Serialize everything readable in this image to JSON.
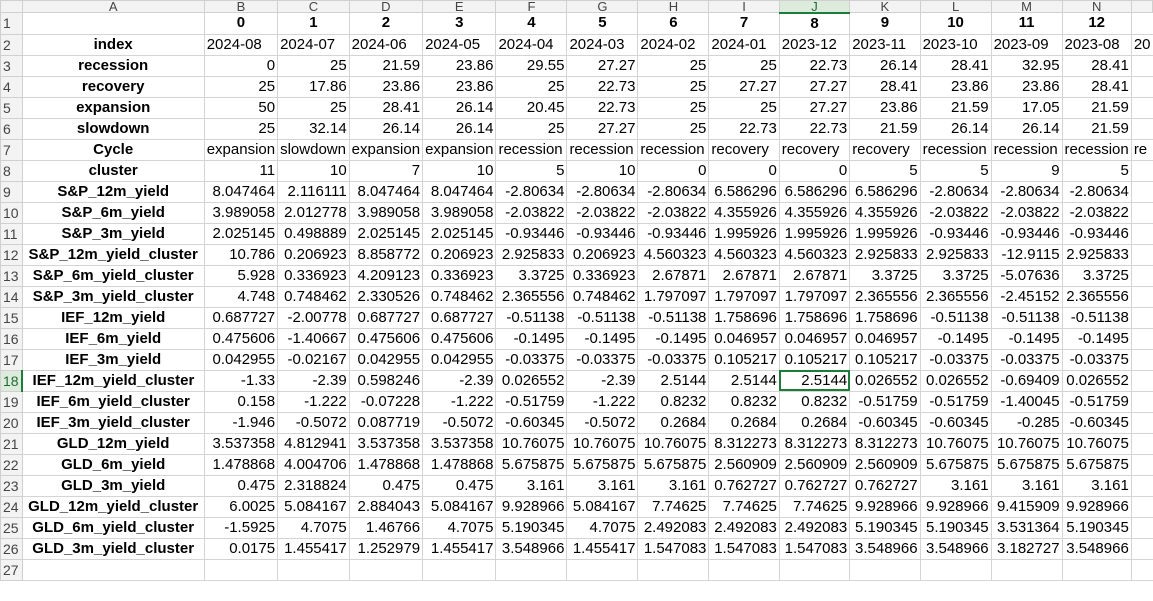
{
  "columns": [
    "A",
    "B",
    "C",
    "D",
    "E",
    "F",
    "G",
    "H",
    "I",
    "J",
    "K",
    "L",
    "M",
    "N",
    ""
  ],
  "selected_column": "J",
  "selected_row": "18",
  "rows": [
    {
      "n": "1",
      "label": "",
      "cells": [
        "0",
        "1",
        "2",
        "3",
        "4",
        "5",
        "6",
        "7",
        "8",
        "9",
        "10",
        "11",
        "12",
        ""
      ],
      "kind": "hdr"
    },
    {
      "n": "2",
      "label": "index",
      "cells": [
        "2024-08",
        "2024-07",
        "2024-06",
        "2024-05",
        "2024-04",
        "2024-03",
        "2024-02",
        "2024-01",
        "2023-12",
        "2023-11",
        "2023-10",
        "2023-09",
        "2023-08",
        "20"
      ],
      "kind": "txt"
    },
    {
      "n": "3",
      "label": "recession",
      "cells": [
        "0",
        "25",
        "21.59",
        "23.86",
        "29.55",
        "27.27",
        "25",
        "25",
        "22.73",
        "26.14",
        "28.41",
        "32.95",
        "28.41",
        ""
      ],
      "kind": "num"
    },
    {
      "n": "4",
      "label": "recovery",
      "cells": [
        "25",
        "17.86",
        "23.86",
        "23.86",
        "25",
        "22.73",
        "25",
        "27.27",
        "27.27",
        "28.41",
        "23.86",
        "23.86",
        "28.41",
        ""
      ],
      "kind": "num"
    },
    {
      "n": "5",
      "label": "expansion",
      "cells": [
        "50",
        "25",
        "28.41",
        "26.14",
        "20.45",
        "22.73",
        "25",
        "25",
        "27.27",
        "23.86",
        "21.59",
        "17.05",
        "21.59",
        ""
      ],
      "kind": "num"
    },
    {
      "n": "6",
      "label": "slowdown",
      "cells": [
        "25",
        "32.14",
        "26.14",
        "26.14",
        "25",
        "27.27",
        "25",
        "22.73",
        "22.73",
        "21.59",
        "26.14",
        "26.14",
        "21.59",
        ""
      ],
      "kind": "num"
    },
    {
      "n": "7",
      "label": "Cycle",
      "cells": [
        "expansion",
        "slowdown",
        "expansion",
        "expansion",
        "recession",
        "recession",
        "recession",
        "recovery",
        "recovery",
        "recovery",
        "recession",
        "recession",
        "recession",
        "re"
      ],
      "kind": "txt"
    },
    {
      "n": "8",
      "label": "cluster",
      "cells": [
        "11",
        "10",
        "7",
        "10",
        "5",
        "10",
        "0",
        "0",
        "0",
        "5",
        "5",
        "9",
        "5",
        ""
      ],
      "kind": "num"
    },
    {
      "n": "9",
      "label": "S&P_12m_yield",
      "cells": [
        "8.047464",
        "2.116111",
        "8.047464",
        "8.047464",
        "-2.80634",
        "-2.80634",
        "-2.80634",
        "6.586296",
        "6.586296",
        "6.586296",
        "-2.80634",
        "-2.80634",
        "-2.80634",
        ""
      ],
      "kind": "num"
    },
    {
      "n": "10",
      "label": "S&P_6m_yield",
      "cells": [
        "3.989058",
        "2.012778",
        "3.989058",
        "3.989058",
        "-2.03822",
        "-2.03822",
        "-2.03822",
        "4.355926",
        "4.355926",
        "4.355926",
        "-2.03822",
        "-2.03822",
        "-2.03822",
        ""
      ],
      "kind": "num"
    },
    {
      "n": "11",
      "label": "S&P_3m_yield",
      "cells": [
        "2.025145",
        "0.498889",
        "2.025145",
        "2.025145",
        "-0.93446",
        "-0.93446",
        "-0.93446",
        "1.995926",
        "1.995926",
        "1.995926",
        "-0.93446",
        "-0.93446",
        "-0.93446",
        ""
      ],
      "kind": "num"
    },
    {
      "n": "12",
      "label": "S&P_12m_yield_cluster",
      "cells": [
        "10.786",
        "0.206923",
        "8.858772",
        "0.206923",
        "2.925833",
        "0.206923",
        "4.560323",
        "4.560323",
        "4.560323",
        "2.925833",
        "2.925833",
        "-12.9115",
        "2.925833",
        ""
      ],
      "kind": "num"
    },
    {
      "n": "13",
      "label": "S&P_6m_yield_cluster",
      "cells": [
        "5.928",
        "0.336923",
        "4.209123",
        "0.336923",
        "3.3725",
        "0.336923",
        "2.67871",
        "2.67871",
        "2.67871",
        "3.3725",
        "3.3725",
        "-5.07636",
        "3.3725",
        ""
      ],
      "kind": "num"
    },
    {
      "n": "14",
      "label": "S&P_3m_yield_cluster",
      "cells": [
        "4.748",
        "0.748462",
        "2.330526",
        "0.748462",
        "2.365556",
        "0.748462",
        "1.797097",
        "1.797097",
        "1.797097",
        "2.365556",
        "2.365556",
        "-2.45152",
        "2.365556",
        ""
      ],
      "kind": "num"
    },
    {
      "n": "15",
      "label": "IEF_12m_yield",
      "cells": [
        "0.687727",
        "-2.00778",
        "0.687727",
        "0.687727",
        "-0.51138",
        "-0.51138",
        "-0.51138",
        "1.758696",
        "1.758696",
        "1.758696",
        "-0.51138",
        "-0.51138",
        "-0.51138",
        ""
      ],
      "kind": "num"
    },
    {
      "n": "16",
      "label": "IEF_6m_yield",
      "cells": [
        "0.475606",
        "-1.40667",
        "0.475606",
        "0.475606",
        "-0.1495",
        "-0.1495",
        "-0.1495",
        "0.046957",
        "0.046957",
        "0.046957",
        "-0.1495",
        "-0.1495",
        "-0.1495",
        ""
      ],
      "kind": "num"
    },
    {
      "n": "17",
      "label": "IEF_3m_yield",
      "cells": [
        "0.042955",
        "-0.02167",
        "0.042955",
        "0.042955",
        "-0.03375",
        "-0.03375",
        "-0.03375",
        "0.105217",
        "0.105217",
        "0.105217",
        "-0.03375",
        "-0.03375",
        "-0.03375",
        ""
      ],
      "kind": "num"
    },
    {
      "n": "18",
      "label": "IEF_12m_yield_cluster",
      "cells": [
        "-1.33",
        "-2.39",
        "0.598246",
        "-2.39",
        "0.026552",
        "-2.39",
        "2.5144",
        "2.5144",
        "2.5144",
        "0.026552",
        "0.026552",
        "-0.69409",
        "0.026552",
        ""
      ],
      "kind": "num"
    },
    {
      "n": "19",
      "label": "IEF_6m_yield_cluster",
      "cells": [
        "0.158",
        "-1.222",
        "-0.07228",
        "-1.222",
        "-0.51759",
        "-1.222",
        "0.8232",
        "0.8232",
        "0.8232",
        "-0.51759",
        "-0.51759",
        "-1.40045",
        "-0.51759",
        ""
      ],
      "kind": "num"
    },
    {
      "n": "20",
      "label": "IEF_3m_yield_cluster",
      "cells": [
        "-1.946",
        "-0.5072",
        "0.087719",
        "-0.5072",
        "-0.60345",
        "-0.5072",
        "0.2684",
        "0.2684",
        "0.2684",
        "-0.60345",
        "-0.60345",
        "-0.285",
        "-0.60345",
        ""
      ],
      "kind": "num"
    },
    {
      "n": "21",
      "label": "GLD_12m_yield",
      "cells": [
        "3.537358",
        "4.812941",
        "3.537358",
        "3.537358",
        "10.76075",
        "10.76075",
        "10.76075",
        "8.312273",
        "8.312273",
        "8.312273",
        "10.76075",
        "10.76075",
        "10.76075",
        ""
      ],
      "kind": "num"
    },
    {
      "n": "22",
      "label": "GLD_6m_yield",
      "cells": [
        "1.478868",
        "4.004706",
        "1.478868",
        "1.478868",
        "5.675875",
        "5.675875",
        "5.675875",
        "2.560909",
        "2.560909",
        "2.560909",
        "5.675875",
        "5.675875",
        "5.675875",
        ""
      ],
      "kind": "num"
    },
    {
      "n": "23",
      "label": "GLD_3m_yield",
      "cells": [
        "0.475",
        "2.318824",
        "0.475",
        "0.475",
        "3.161",
        "3.161",
        "3.161",
        "0.762727",
        "0.762727",
        "0.762727",
        "3.161",
        "3.161",
        "3.161",
        ""
      ],
      "kind": "num"
    },
    {
      "n": "24",
      "label": "GLD_12m_yield_cluster",
      "cells": [
        "6.0025",
        "5.084167",
        "2.884043",
        "5.084167",
        "9.928966",
        "5.084167",
        "7.74625",
        "7.74625",
        "7.74625",
        "9.928966",
        "9.928966",
        "9.415909",
        "9.928966",
        ""
      ],
      "kind": "num"
    },
    {
      "n": "25",
      "label": "GLD_6m_yield_cluster",
      "cells": [
        "-1.5925",
        "4.7075",
        "1.46766",
        "4.7075",
        "5.190345",
        "4.7075",
        "2.492083",
        "2.492083",
        "2.492083",
        "5.190345",
        "5.190345",
        "3.531364",
        "5.190345",
        ""
      ],
      "kind": "num"
    },
    {
      "n": "26",
      "label": "GLD_3m_yield_cluster",
      "cells": [
        "0.0175",
        "1.455417",
        "1.252979",
        "1.455417",
        "3.548966",
        "1.455417",
        "1.547083",
        "1.547083",
        "1.547083",
        "3.548966",
        "3.548966",
        "3.182727",
        "3.548966",
        ""
      ],
      "kind": "num"
    },
    {
      "n": "27",
      "label": "",
      "cells": [
        "",
        "",
        "",
        "",
        "",
        "",
        "",
        "",
        "",
        "",
        "",
        "",
        "",
        ""
      ],
      "kind": "num"
    }
  ]
}
